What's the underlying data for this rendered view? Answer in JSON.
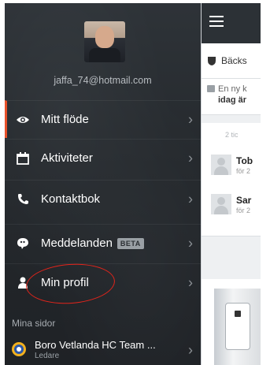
{
  "profile": {
    "email": "jaffa_74@hotmail.com"
  },
  "menu": {
    "items": [
      {
        "label": "Mitt flöde",
        "icon": "eye-icon",
        "active": true
      },
      {
        "label": "Aktiviteter",
        "icon": "calendar-icon",
        "active": false
      },
      {
        "label": "Kontaktbok",
        "icon": "phone-icon",
        "active": false
      },
      {
        "label": "Meddelanden",
        "icon": "chat-icon",
        "active": false,
        "badge": "BETA"
      },
      {
        "label": "Min profil",
        "icon": "person-icon",
        "active": false
      }
    ]
  },
  "section": {
    "title": "Mina sidor"
  },
  "team": {
    "name": "Boro Vetlanda HC Team ...",
    "role": "Ledare"
  },
  "content": {
    "club": "Bäcks",
    "notice_line1": "En ny k",
    "notice_line2": "idag är",
    "feed_time": "2 tic",
    "people": [
      {
        "name": "Tob",
        "sub": "för 2"
      },
      {
        "name": "Sar",
        "sub": "för 2"
      }
    ]
  },
  "colors": {
    "accent": "#e8512a",
    "annotation": "#e4241b",
    "drawer": "#2a2e33"
  }
}
